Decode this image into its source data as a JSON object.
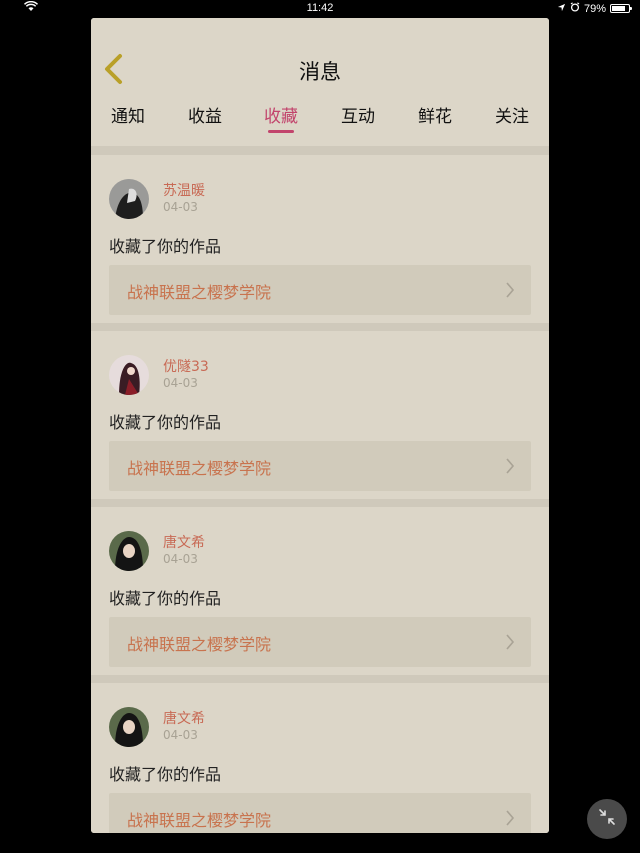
{
  "status": {
    "time": "11:42",
    "battery": "79%",
    "battery_level": 0.79
  },
  "header": {
    "title": "消息"
  },
  "tabs": [
    {
      "label": "通知"
    },
    {
      "label": "收益"
    },
    {
      "label": "收藏",
      "active": true
    },
    {
      "label": "互动"
    },
    {
      "label": "鲜花"
    },
    {
      "label": "关注"
    }
  ],
  "messages": [
    {
      "user": "苏温暖",
      "date": "04-03",
      "action": "收藏了你的作品",
      "work": "战神联盟之樱梦学院"
    },
    {
      "user": "优隧33",
      "date": "04-03",
      "action": "收藏了你的作品",
      "work": "战神联盟之樱梦学院"
    },
    {
      "user": "唐文希",
      "date": "04-03",
      "action": "收藏了你的作品",
      "work": "战神联盟之樱梦学院"
    },
    {
      "user": "唐文希",
      "date": "04-03",
      "action": "收藏了你的作品",
      "work": "战神联盟之樱梦学院"
    }
  ],
  "colors": {
    "accent": "#c2446c",
    "username": "#c86a55",
    "work_title": "#c8734e",
    "back_arrow": "#b9a028"
  },
  "icons": {
    "back": "chevron-left-icon",
    "work_arrow": "chevron-right-icon",
    "minimize": "minimize-icon"
  }
}
